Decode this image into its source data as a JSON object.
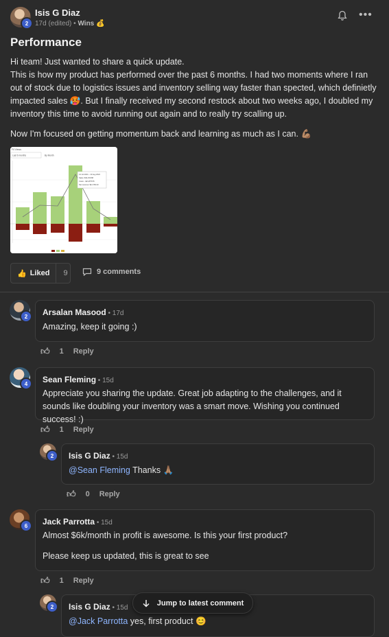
{
  "post": {
    "author": "Isis G Diaz",
    "author_level": "2",
    "meta_time": "17d (edited)",
    "meta_sep": " • ",
    "category": "Wins",
    "category_emoji": "💰",
    "title": "Performance",
    "paragraphs": [
      "Hi team! Just wanted to share a quick update.\nThis is how my product has performed over the past 6 months. I had two moments where I ran out of stock due to logistics issues and inventory selling way faster than spected, which definietly impacted sales 🥵. But I finally received my second restock about two weeks ago, I doubled my inventory this time to avoid running out again and to really try scalling up.",
      "Now I'm focused on getting momentum back and learning as much as I can. 💪🏽"
    ],
    "bell_icon": "bell-icon",
    "more_icon": "more-icon",
    "like_label": "Liked",
    "like_count": "9",
    "comments_label": "9 comments",
    "chart_header": "Fil Views",
    "chart_select": "Last 6 months",
    "chart_select2": "By Month",
    "chart_tooltip": [
      "13 Jul 2024 – 13 Aug 2024",
      "Sales: $34,159.88",
      "Costs: −$21,875.55",
      "Net revenue: $12,783.33"
    ]
  },
  "comments": [
    {
      "author": "Arsalan Masood",
      "level": "2",
      "time": "17d",
      "text": "Amazing, keep it going :)",
      "likes": "1",
      "reply": "Reply"
    },
    {
      "author": "Sean Fleming",
      "level": "4",
      "time": "15d",
      "text": "Appreciate you sharing the update. Great job adapting to the challenges, and it sounds like doubling your inventory was a smart move. Wishing you continued success! :)",
      "likes": "1",
      "reply": "Reply"
    },
    {
      "author": "Isis G Diaz",
      "level": "2",
      "time": "15d",
      "mention": "@Sean Fleming",
      "text": " Thanks 🙏🏽",
      "likes": "0",
      "reply": "Reply"
    },
    {
      "author": "Jack Parrotta",
      "level": "6",
      "time": "15d",
      "text": "Almost $6k/month in profit is awesome. Is this your first product?",
      "text2": "Please keep us updated, this is great to see",
      "likes": "1",
      "reply": "Reply"
    },
    {
      "author": "Isis G Diaz",
      "level": "2",
      "time": "15d",
      "mention": "@Jack Parrotta",
      "text": " yes, first product 😊"
    }
  ],
  "jump_label": "Jump to latest comment",
  "dot": " • "
}
